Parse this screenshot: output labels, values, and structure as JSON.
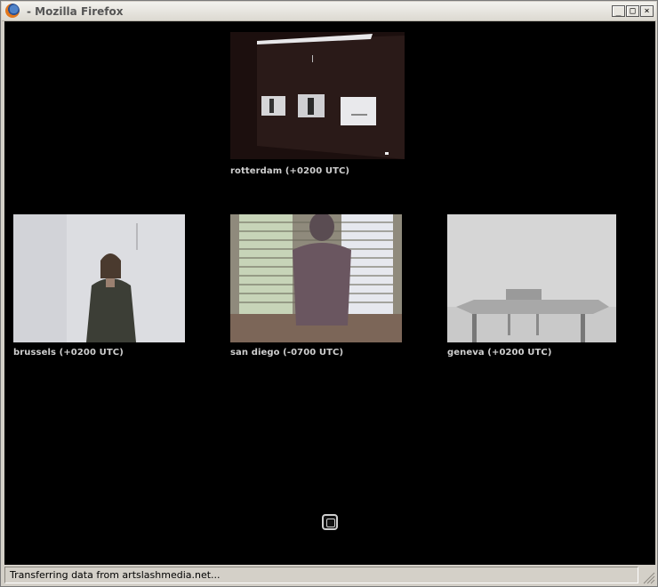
{
  "window": {
    "title": "- Mozilla Firefox",
    "minimize_glyph": "_",
    "maximize_glyph": "□",
    "close_glyph": "×"
  },
  "cameras": [
    {
      "label": "rotterdam (+0200 UTC)",
      "image": "rotterdam-projection-room"
    },
    {
      "label": "brussels (+0200 UTC)",
      "image": "woman-standing-white-wall"
    },
    {
      "label": "san diego (-0700 UTC)",
      "image": "person-silhouette-window-blinds"
    },
    {
      "label": "geneva (+0200 UTC)",
      "image": "table-and-chair-grey-room"
    }
  ],
  "status": {
    "text": "Transferring data from artslashmedia.net..."
  },
  "colors": {
    "page_background": "#000000",
    "label_text": "#cfcfcf",
    "chrome": "#d4d0c8"
  }
}
